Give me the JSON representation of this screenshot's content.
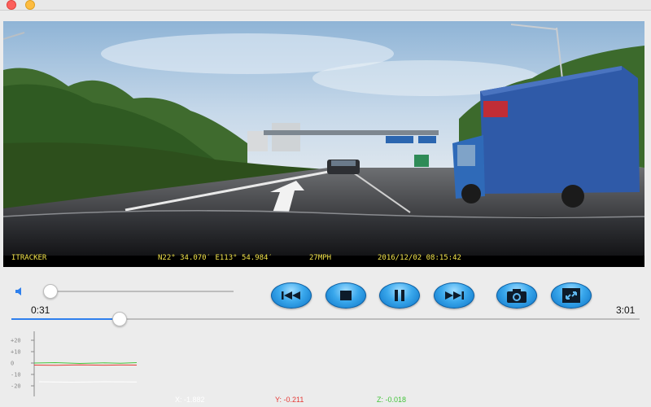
{
  "window": {
    "buttons": [
      "close",
      "minimize"
    ]
  },
  "video": {
    "osd": {
      "brand": "ITRACKER",
      "gps": "N22° 34.070′ E113° 54.984′",
      "speed": "27MPH",
      "datetime": "2016/12/02 08:15:42"
    }
  },
  "volume": {
    "level": 0.03
  },
  "controls": [
    {
      "name": "previous-button",
      "icon": "skip-back-icon"
    },
    {
      "name": "stop-button",
      "icon": "stop-icon"
    },
    {
      "name": "pause-button",
      "icon": "pause-icon"
    },
    {
      "name": "next-button",
      "icon": "skip-forward-icon"
    },
    {
      "name": "snapshot-button",
      "icon": "camera-icon"
    },
    {
      "name": "fullscreen-button",
      "icon": "fullscreen-icon"
    }
  ],
  "playback": {
    "current_time": "0:31",
    "total_time": "3:01",
    "progress": 0.172
  },
  "gsensor": {
    "yticks": [
      "+20",
      "+10",
      "0",
      "-10",
      "-20"
    ],
    "ylim": [
      -25,
      25
    ],
    "x": {
      "label": "X: -1.882",
      "color": "#ffffff"
    },
    "y": {
      "label": "Y: -0.211",
      "color": "#e53935"
    },
    "z": {
      "label": "Z: -0.018",
      "color": "#43c43a"
    }
  },
  "colors": {
    "accent": "#2f80ed",
    "button": "#1e8fe0",
    "osd": "#f3e44a"
  }
}
